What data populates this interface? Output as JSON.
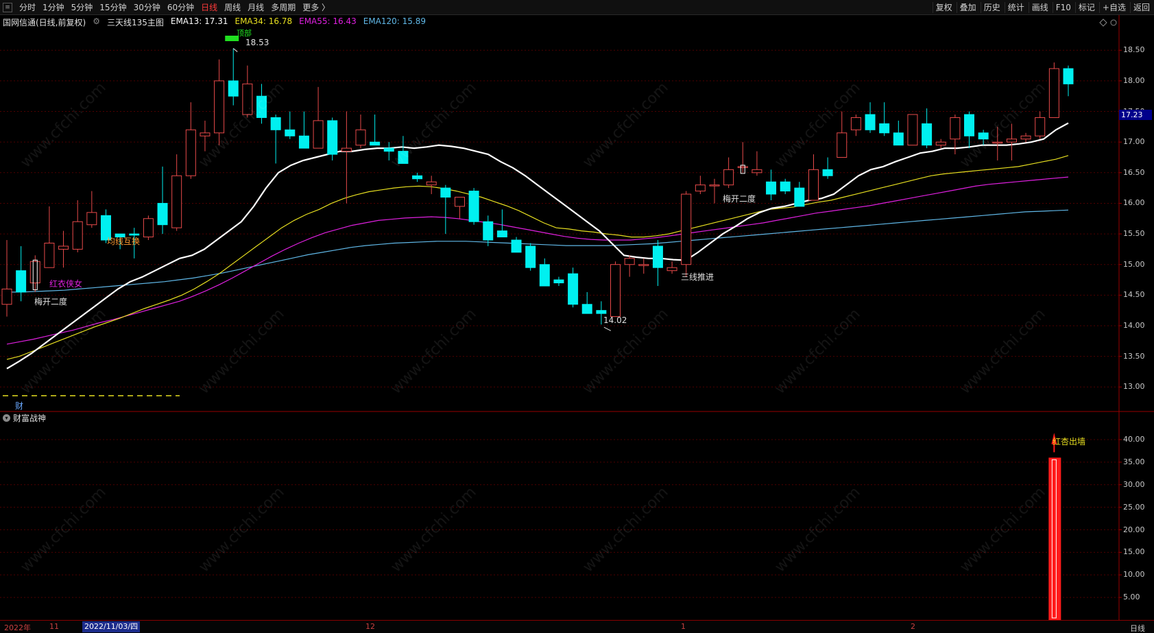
{
  "toolbar": {
    "periods": [
      "分时",
      "1分钟",
      "5分钟",
      "15分钟",
      "30分钟",
      "60分钟",
      "日线",
      "周线",
      "月线",
      "多周期",
      "更多 〉"
    ],
    "active_period": "日线",
    "right_buttons": [
      "复权",
      "叠加",
      "历史",
      "统计",
      "画线",
      "F10",
      "标记",
      "+自选",
      "返回"
    ]
  },
  "main_header": {
    "title": "国网信通(日线,前复权)",
    "indicator_name": "三天线135主图",
    "ema13": "EMA13: 17.31",
    "ema34": "EMA34: 16.78",
    "ema55": "EMA55: 16.43",
    "ema120": "EMA120: 15.89"
  },
  "sub_header": {
    "indicator_name": "财富战神"
  },
  "price_axis": [
    "18.50",
    "18.00",
    "17.50",
    "17.00",
    "16.50",
    "16.00",
    "15.50",
    "15.00",
    "14.50",
    "14.00",
    "13.50",
    "13.00"
  ],
  "current_price": "17.23",
  "sub_axis": [
    "40.00",
    "35.00",
    "30.00",
    "25.00",
    "20.00",
    "15.00",
    "10.00",
    "5.00"
  ],
  "date_bar": {
    "year": "2022年",
    "labels": [
      "11",
      "12",
      "1",
      "2"
    ],
    "cursor": "2022/11/03/四",
    "period": "日线"
  },
  "annotations": {
    "high": "18.53",
    "low": "14.02",
    "meikai1": "梅开二度",
    "meikai2": "梅开二度",
    "junxian": "均线互换",
    "hongyi": "红衣侠女",
    "sanxian": "三线推进",
    "hongxing": "红杏出墙",
    "cai": "财",
    "top_partial": "顶部"
  },
  "watermark": "www.cfchi.com",
  "colors": {
    "up": "#e84a4a",
    "down": "#00f0f0",
    "ema13": "#ffffff",
    "ema34": "#e8e020",
    "ema55": "#e020e0",
    "ema120": "#60b8e8",
    "grid": "#500000"
  },
  "chart_data": {
    "type": "candlestick",
    "candles": [
      {
        "o": 14.35,
        "h": 15.4,
        "l": 14.15,
        "c": 14.6
      },
      {
        "o": 14.9,
        "h": 15.3,
        "l": 14.4,
        "c": 14.55
      },
      {
        "o": 14.7,
        "h": 15.15,
        "l": 14.55,
        "c": 15.05
      },
      {
        "o": 14.95,
        "h": 15.95,
        "l": 14.95,
        "c": 15.35
      },
      {
        "o": 15.25,
        "h": 15.55,
        "l": 14.95,
        "c": 15.3
      },
      {
        "o": 15.25,
        "h": 16.05,
        "l": 15.2,
        "c": 15.7
      },
      {
        "o": 15.65,
        "h": 16.2,
        "l": 15.6,
        "c": 15.85
      },
      {
        "o": 15.8,
        "h": 15.9,
        "l": 15.35,
        "c": 15.4
      },
      {
        "o": 15.5,
        "h": 15.5,
        "l": 15.25,
        "c": 15.45
      },
      {
        "o": 15.5,
        "h": 15.6,
        "l": 15.1,
        "c": 15.48
      },
      {
        "o": 15.45,
        "h": 15.8,
        "l": 15.4,
        "c": 15.75
      },
      {
        "o": 16.0,
        "h": 16.6,
        "l": 15.5,
        "c": 15.65
      },
      {
        "o": 15.6,
        "h": 16.8,
        "l": 15.55,
        "c": 16.45
      },
      {
        "o": 16.45,
        "h": 17.65,
        "l": 16.4,
        "c": 17.2
      },
      {
        "o": 17.1,
        "h": 17.35,
        "l": 16.85,
        "c": 17.15
      },
      {
        "o": 17.15,
        "h": 18.35,
        "l": 16.95,
        "c": 18.0
      },
      {
        "o": 18.0,
        "h": 18.53,
        "l": 17.6,
        "c": 17.75
      },
      {
        "o": 17.45,
        "h": 18.25,
        "l": 17.4,
        "c": 17.95
      },
      {
        "o": 17.75,
        "h": 17.95,
        "l": 17.3,
        "c": 17.4
      },
      {
        "o": 17.4,
        "h": 17.45,
        "l": 16.65,
        "c": 17.2
      },
      {
        "o": 17.2,
        "h": 17.5,
        "l": 17.05,
        "c": 17.1
      },
      {
        "o": 17.1,
        "h": 17.5,
        "l": 16.9,
        "c": 16.9
      },
      {
        "o": 16.9,
        "h": 17.9,
        "l": 16.9,
        "c": 17.35
      },
      {
        "o": 17.35,
        "h": 17.4,
        "l": 16.7,
        "c": 16.8
      },
      {
        "o": 16.85,
        "h": 17.5,
        "l": 16.0,
        "c": 16.9
      },
      {
        "o": 16.95,
        "h": 17.45,
        "l": 16.9,
        "c": 17.2
      },
      {
        "o": 17.0,
        "h": 17.45,
        "l": 16.95,
        "c": 16.95
      },
      {
        "o": 16.9,
        "h": 17.0,
        "l": 16.7,
        "c": 16.85
      },
      {
        "o": 16.85,
        "h": 17.1,
        "l": 16.65,
        "c": 16.65
      },
      {
        "o": 16.45,
        "h": 16.5,
        "l": 16.35,
        "c": 16.4
      },
      {
        "o": 16.3,
        "h": 16.45,
        "l": 16.15,
        "c": 16.35
      },
      {
        "o": 16.25,
        "h": 16.3,
        "l": 15.5,
        "c": 16.1
      },
      {
        "o": 15.95,
        "h": 16.0,
        "l": 15.75,
        "c": 16.1
      },
      {
        "o": 16.2,
        "h": 16.25,
        "l": 15.65,
        "c": 15.7
      },
      {
        "o": 15.7,
        "h": 15.8,
        "l": 15.3,
        "c": 15.4
      },
      {
        "o": 15.55,
        "h": 15.9,
        "l": 15.45,
        "c": 15.45
      },
      {
        "o": 15.4,
        "h": 15.45,
        "l": 15.3,
        "c": 15.2
      },
      {
        "o": 15.3,
        "h": 15.35,
        "l": 14.9,
        "c": 14.95
      },
      {
        "o": 15.0,
        "h": 15.1,
        "l": 14.7,
        "c": 14.65
      },
      {
        "o": 14.75,
        "h": 14.8,
        "l": 14.65,
        "c": 14.7
      },
      {
        "o": 14.85,
        "h": 14.95,
        "l": 14.3,
        "c": 14.35
      },
      {
        "o": 14.35,
        "h": 14.55,
        "l": 14.2,
        "c": 14.2
      },
      {
        "o": 14.25,
        "h": 14.4,
        "l": 14.02,
        "c": 14.2
      },
      {
        "o": 14.15,
        "h": 15.05,
        "l": 14.15,
        "c": 15.0
      },
      {
        "o": 15.0,
        "h": 15.15,
        "l": 14.8,
        "c": 15.1
      },
      {
        "o": 15.0,
        "h": 15.1,
        "l": 14.85,
        "c": 15.0
      },
      {
        "o": 15.3,
        "h": 15.4,
        "l": 14.65,
        "c": 14.95
      },
      {
        "o": 14.9,
        "h": 15.05,
        "l": 14.85,
        "c": 14.95
      },
      {
        "o": 15.0,
        "h": 16.2,
        "l": 14.8,
        "c": 16.15
      },
      {
        "o": 16.2,
        "h": 16.45,
        "l": 16.15,
        "c": 16.3
      },
      {
        "o": 16.3,
        "h": 16.4,
        "l": 16.0,
        "c": 16.3
      },
      {
        "o": 16.3,
        "h": 16.75,
        "l": 16.25,
        "c": 16.55
      },
      {
        "o": 16.6,
        "h": 17.0,
        "l": 16.5,
        "c": 16.6
      },
      {
        "o": 16.5,
        "h": 16.85,
        "l": 16.45,
        "c": 16.55
      },
      {
        "o": 16.35,
        "h": 16.55,
        "l": 16.05,
        "c": 16.15
      },
      {
        "o": 16.35,
        "h": 16.4,
        "l": 16.15,
        "c": 16.2
      },
      {
        "o": 16.25,
        "h": 16.35,
        "l": 15.95,
        "c": 15.95
      },
      {
        "o": 16.05,
        "h": 16.8,
        "l": 16.05,
        "c": 16.55
      },
      {
        "o": 16.55,
        "h": 16.75,
        "l": 16.4,
        "c": 16.45
      },
      {
        "o": 16.75,
        "h": 17.5,
        "l": 16.75,
        "c": 17.15
      },
      {
        "o": 17.2,
        "h": 17.45,
        "l": 17.1,
        "c": 17.4
      },
      {
        "o": 17.45,
        "h": 17.65,
        "l": 17.15,
        "c": 17.2
      },
      {
        "o": 17.3,
        "h": 17.65,
        "l": 17.1,
        "c": 17.15
      },
      {
        "o": 17.15,
        "h": 17.35,
        "l": 17.05,
        "c": 16.95
      },
      {
        "o": 16.95,
        "h": 17.45,
        "l": 16.95,
        "c": 17.45
      },
      {
        "o": 17.3,
        "h": 17.55,
        "l": 16.9,
        "c": 16.95
      },
      {
        "o": 16.95,
        "h": 17.05,
        "l": 16.9,
        "c": 17.0
      },
      {
        "o": 17.05,
        "h": 17.45,
        "l": 16.8,
        "c": 17.4
      },
      {
        "o": 17.45,
        "h": 17.5,
        "l": 16.9,
        "c": 17.1
      },
      {
        "o": 17.15,
        "h": 17.2,
        "l": 16.95,
        "c": 17.05
      },
      {
        "o": 17.0,
        "h": 17.25,
        "l": 16.7,
        "c": 17.0
      },
      {
        "o": 17.0,
        "h": 17.3,
        "l": 16.7,
        "c": 17.05
      },
      {
        "o": 17.05,
        "h": 17.15,
        "l": 17.0,
        "c": 17.1
      },
      {
        "o": 17.1,
        "h": 17.5,
        "l": 17.05,
        "c": 17.4
      },
      {
        "o": 17.4,
        "h": 18.3,
        "l": 17.4,
        "c": 18.2
      },
      {
        "o": 18.2,
        "h": 18.25,
        "l": 17.75,
        "c": 17.95
      }
    ],
    "ema13": [
      13.3,
      13.42,
      13.55,
      13.7,
      13.85,
      14.0,
      14.15,
      14.3,
      14.45,
      14.6,
      14.72,
      14.8,
      14.9,
      15.0,
      15.1,
      15.15,
      15.25,
      15.4,
      15.55,
      15.7,
      15.95,
      16.25,
      16.5,
      16.62,
      16.7,
      16.75,
      16.8,
      16.85,
      16.85,
      16.88,
      16.9,
      16.9,
      16.92,
      16.9,
      16.92,
      16.95,
      16.93,
      16.9,
      16.85,
      16.8,
      16.68,
      16.58,
      16.45,
      16.3,
      16.15,
      16.0,
      15.85,
      15.7,
      15.55,
      15.35,
      15.15,
      15.12,
      15.1,
      15.1,
      15.08,
      15.07,
      15.2,
      15.35,
      15.5,
      15.62,
      15.75,
      15.85,
      15.92,
      15.95,
      16.0,
      16.05,
      16.08,
      16.15,
      16.3,
      16.45,
      16.55,
      16.6,
      16.68,
      16.75,
      16.82,
      16.85,
      16.9,
      16.9,
      16.92,
      16.95,
      16.95,
      16.95,
      16.97,
      17.0,
      17.05,
      17.2,
      17.31
    ],
    "ema34": [
      13.45,
      13.5,
      13.58,
      13.66,
      13.74,
      13.82,
      13.9,
      13.98,
      14.05,
      14.12,
      14.2,
      14.28,
      14.35,
      14.42,
      14.5,
      14.6,
      14.72,
      14.85,
      15.0,
      15.15,
      15.3,
      15.45,
      15.6,
      15.72,
      15.82,
      15.9,
      16.0,
      16.08,
      16.14,
      16.19,
      16.22,
      16.25,
      16.27,
      16.28,
      16.27,
      16.24,
      16.2,
      16.15,
      16.1,
      16.03,
      15.96,
      15.88,
      15.78,
      15.68,
      15.6,
      15.58,
      15.55,
      15.53,
      15.5,
      15.48,
      15.45,
      15.45,
      15.47,
      15.5,
      15.55,
      15.6,
      15.65,
      15.7,
      15.75,
      15.8,
      15.85,
      15.9,
      15.92,
      15.94,
      15.98,
      16.02,
      16.05,
      16.1,
      16.15,
      16.2,
      16.25,
      16.3,
      16.35,
      16.4,
      16.45,
      16.48,
      16.5,
      16.52,
      16.54,
      16.56,
      16.58,
      16.6,
      16.64,
      16.68,
      16.72,
      16.78
    ],
    "ema55": [
      13.7,
      13.74,
      13.78,
      13.83,
      13.88,
      13.93,
      13.99,
      14.05,
      14.1,
      14.16,
      14.22,
      14.28,
      14.34,
      14.4,
      14.48,
      14.57,
      14.67,
      14.78,
      14.9,
      15.02,
      15.14,
      15.25,
      15.35,
      15.44,
      15.52,
      15.58,
      15.64,
      15.68,
      15.72,
      15.74,
      15.76,
      15.77,
      15.78,
      15.77,
      15.75,
      15.72,
      15.69,
      15.66,
      15.62,
      15.58,
      15.54,
      15.5,
      15.46,
      15.43,
      15.41,
      15.4,
      15.4,
      15.4,
      15.42,
      15.44,
      15.47,
      15.5,
      15.53,
      15.56,
      15.59,
      15.62,
      15.65,
      15.68,
      15.72,
      15.76,
      15.8,
      15.84,
      15.87,
      15.9,
      15.93,
      15.96,
      16.0,
      16.04,
      16.08,
      16.12,
      16.16,
      16.2,
      16.24,
      16.28,
      16.31,
      16.33,
      16.35,
      16.37,
      16.39,
      16.41,
      16.43
    ],
    "ema120": [
      14.55,
      14.55,
      14.56,
      14.57,
      14.58,
      14.6,
      14.62,
      14.64,
      14.66,
      14.68,
      14.7,
      14.72,
      14.75,
      14.78,
      14.82,
      14.86,
      14.91,
      14.96,
      15.01,
      15.06,
      15.11,
      15.16,
      15.2,
      15.24,
      15.28,
      15.31,
      15.33,
      15.35,
      15.36,
      15.37,
      15.38,
      15.38,
      15.38,
      15.37,
      15.36,
      15.35,
      15.34,
      15.33,
      15.32,
      15.31,
      15.31,
      15.31,
      15.31,
      15.32,
      15.33,
      15.34,
      15.36,
      15.38,
      15.4,
      15.42,
      15.44,
      15.46,
      15.48,
      15.5,
      15.52,
      15.54,
      15.56,
      15.58,
      15.6,
      15.62,
      15.64,
      15.66,
      15.68,
      15.7,
      15.72,
      15.74,
      15.76,
      15.78,
      15.8,
      15.82,
      15.84,
      15.86,
      15.87,
      15.88,
      15.89
    ],
    "price_range": [
      12.6,
      18.85
    ],
    "sub_signal": {
      "candle_index": 74,
      "value": 36.0
    },
    "sub_range": [
      0,
      43.5
    ]
  }
}
